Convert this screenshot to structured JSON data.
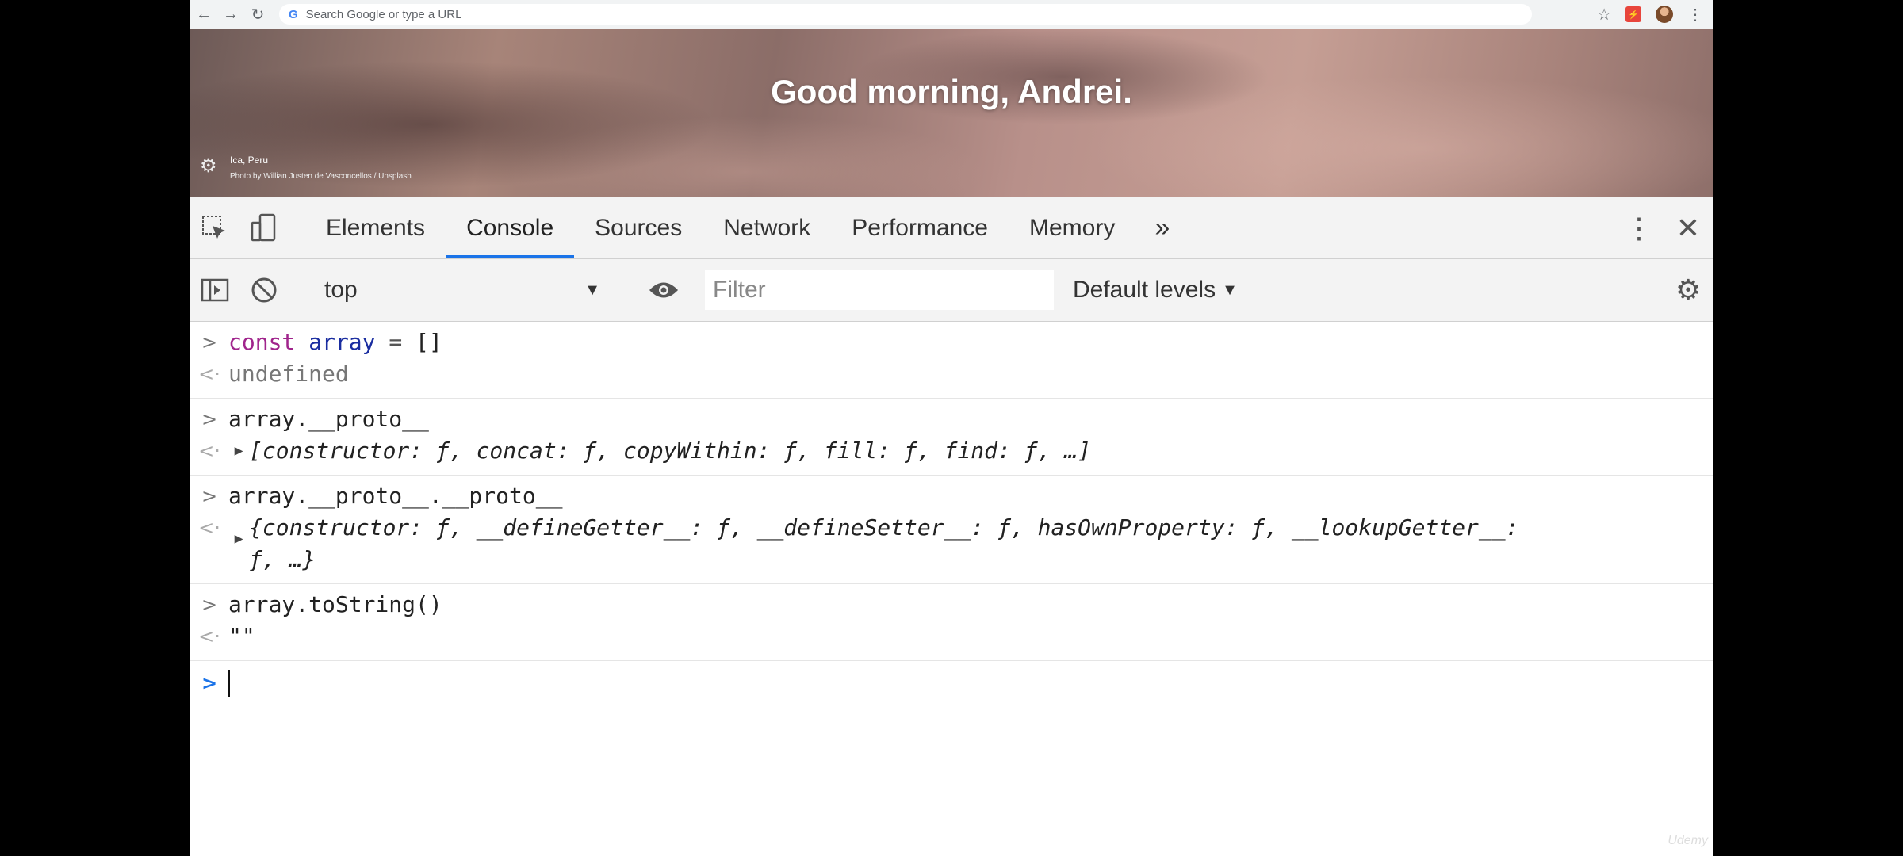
{
  "browser": {
    "omnibox_placeholder": "Search Google or type a URL",
    "extension_badge": "⚡"
  },
  "banner": {
    "greeting": "Good morning, Andrei.",
    "location": "Ica, Peru",
    "photo_credit": "Photo by Willian Justen de Vasconcellos / Unsplash"
  },
  "devtools": {
    "tabs": [
      "Elements",
      "Console",
      "Sources",
      "Network",
      "Performance",
      "Memory"
    ],
    "active_tab": "Console",
    "more_tabs_label": "»",
    "context": "top",
    "filter_placeholder": "Filter",
    "levels_label": "Default levels"
  },
  "console": {
    "entries": [
      {
        "input": "const array = []",
        "output": "undefined"
      },
      {
        "input": "array.__proto__",
        "output": "[constructor: ƒ, concat: ƒ, copyWithin: ƒ, fill: ƒ, find: ƒ, …]"
      },
      {
        "input": "array.__proto__.__proto__",
        "output": "{constructor: ƒ, __defineGetter__: ƒ, __defineSetter__: ƒ, hasOwnProperty: ƒ, __lookupGetter__: ƒ, …}"
      },
      {
        "input": "array.toString()",
        "output": "\"\""
      }
    ]
  },
  "watermark": "Udemy",
  "colors": {
    "accent": "#1a73e8",
    "keyword": "#a0248c",
    "variable": "#1a2da0"
  }
}
